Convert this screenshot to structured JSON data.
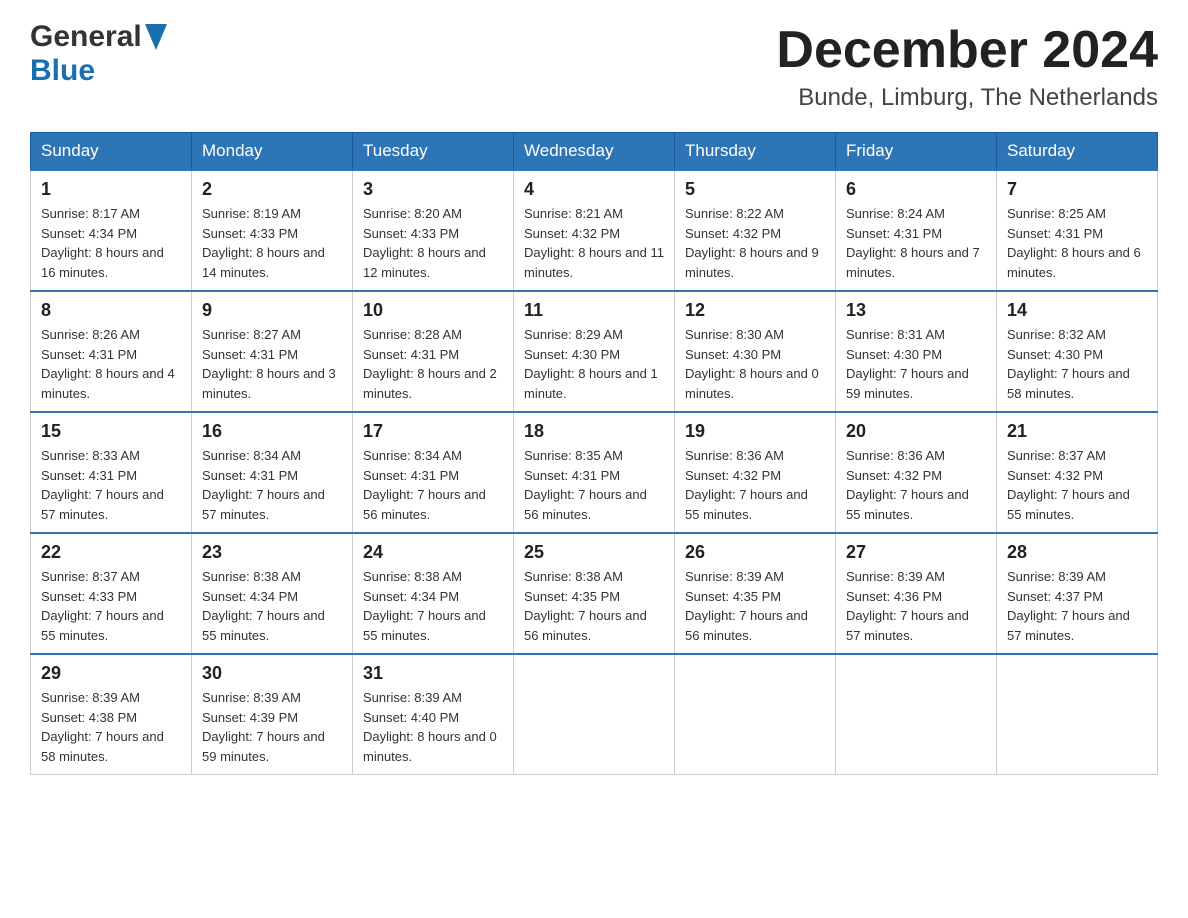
{
  "header": {
    "logo_general": "General",
    "logo_blue": "Blue",
    "main_title": "December 2024",
    "subtitle": "Bunde, Limburg, The Netherlands"
  },
  "days_of_week": [
    "Sunday",
    "Monday",
    "Tuesday",
    "Wednesday",
    "Thursday",
    "Friday",
    "Saturday"
  ],
  "weeks": [
    [
      {
        "day": "1",
        "sunrise": "8:17 AM",
        "sunset": "4:34 PM",
        "daylight": "8 hours and 16 minutes."
      },
      {
        "day": "2",
        "sunrise": "8:19 AM",
        "sunset": "4:33 PM",
        "daylight": "8 hours and 14 minutes."
      },
      {
        "day": "3",
        "sunrise": "8:20 AM",
        "sunset": "4:33 PM",
        "daylight": "8 hours and 12 minutes."
      },
      {
        "day": "4",
        "sunrise": "8:21 AM",
        "sunset": "4:32 PM",
        "daylight": "8 hours and 11 minutes."
      },
      {
        "day": "5",
        "sunrise": "8:22 AM",
        "sunset": "4:32 PM",
        "daylight": "8 hours and 9 minutes."
      },
      {
        "day": "6",
        "sunrise": "8:24 AM",
        "sunset": "4:31 PM",
        "daylight": "8 hours and 7 minutes."
      },
      {
        "day": "7",
        "sunrise": "8:25 AM",
        "sunset": "4:31 PM",
        "daylight": "8 hours and 6 minutes."
      }
    ],
    [
      {
        "day": "8",
        "sunrise": "8:26 AM",
        "sunset": "4:31 PM",
        "daylight": "8 hours and 4 minutes."
      },
      {
        "day": "9",
        "sunrise": "8:27 AM",
        "sunset": "4:31 PM",
        "daylight": "8 hours and 3 minutes."
      },
      {
        "day": "10",
        "sunrise": "8:28 AM",
        "sunset": "4:31 PM",
        "daylight": "8 hours and 2 minutes."
      },
      {
        "day": "11",
        "sunrise": "8:29 AM",
        "sunset": "4:30 PM",
        "daylight": "8 hours and 1 minute."
      },
      {
        "day": "12",
        "sunrise": "8:30 AM",
        "sunset": "4:30 PM",
        "daylight": "8 hours and 0 minutes."
      },
      {
        "day": "13",
        "sunrise": "8:31 AM",
        "sunset": "4:30 PM",
        "daylight": "7 hours and 59 minutes."
      },
      {
        "day": "14",
        "sunrise": "8:32 AM",
        "sunset": "4:30 PM",
        "daylight": "7 hours and 58 minutes."
      }
    ],
    [
      {
        "day": "15",
        "sunrise": "8:33 AM",
        "sunset": "4:31 PM",
        "daylight": "7 hours and 57 minutes."
      },
      {
        "day": "16",
        "sunrise": "8:34 AM",
        "sunset": "4:31 PM",
        "daylight": "7 hours and 57 minutes."
      },
      {
        "day": "17",
        "sunrise": "8:34 AM",
        "sunset": "4:31 PM",
        "daylight": "7 hours and 56 minutes."
      },
      {
        "day": "18",
        "sunrise": "8:35 AM",
        "sunset": "4:31 PM",
        "daylight": "7 hours and 56 minutes."
      },
      {
        "day": "19",
        "sunrise": "8:36 AM",
        "sunset": "4:32 PM",
        "daylight": "7 hours and 55 minutes."
      },
      {
        "day": "20",
        "sunrise": "8:36 AM",
        "sunset": "4:32 PM",
        "daylight": "7 hours and 55 minutes."
      },
      {
        "day": "21",
        "sunrise": "8:37 AM",
        "sunset": "4:32 PM",
        "daylight": "7 hours and 55 minutes."
      }
    ],
    [
      {
        "day": "22",
        "sunrise": "8:37 AM",
        "sunset": "4:33 PM",
        "daylight": "7 hours and 55 minutes."
      },
      {
        "day": "23",
        "sunrise": "8:38 AM",
        "sunset": "4:34 PM",
        "daylight": "7 hours and 55 minutes."
      },
      {
        "day": "24",
        "sunrise": "8:38 AM",
        "sunset": "4:34 PM",
        "daylight": "7 hours and 55 minutes."
      },
      {
        "day": "25",
        "sunrise": "8:38 AM",
        "sunset": "4:35 PM",
        "daylight": "7 hours and 56 minutes."
      },
      {
        "day": "26",
        "sunrise": "8:39 AM",
        "sunset": "4:35 PM",
        "daylight": "7 hours and 56 minutes."
      },
      {
        "day": "27",
        "sunrise": "8:39 AM",
        "sunset": "4:36 PM",
        "daylight": "7 hours and 57 minutes."
      },
      {
        "day": "28",
        "sunrise": "8:39 AM",
        "sunset": "4:37 PM",
        "daylight": "7 hours and 57 minutes."
      }
    ],
    [
      {
        "day": "29",
        "sunrise": "8:39 AM",
        "sunset": "4:38 PM",
        "daylight": "7 hours and 58 minutes."
      },
      {
        "day": "30",
        "sunrise": "8:39 AM",
        "sunset": "4:39 PM",
        "daylight": "7 hours and 59 minutes."
      },
      {
        "day": "31",
        "sunrise": "8:39 AM",
        "sunset": "4:40 PM",
        "daylight": "8 hours and 0 minutes."
      },
      null,
      null,
      null,
      null
    ]
  ],
  "labels": {
    "sunrise": "Sunrise:",
    "sunset": "Sunset:",
    "daylight": "Daylight:"
  }
}
